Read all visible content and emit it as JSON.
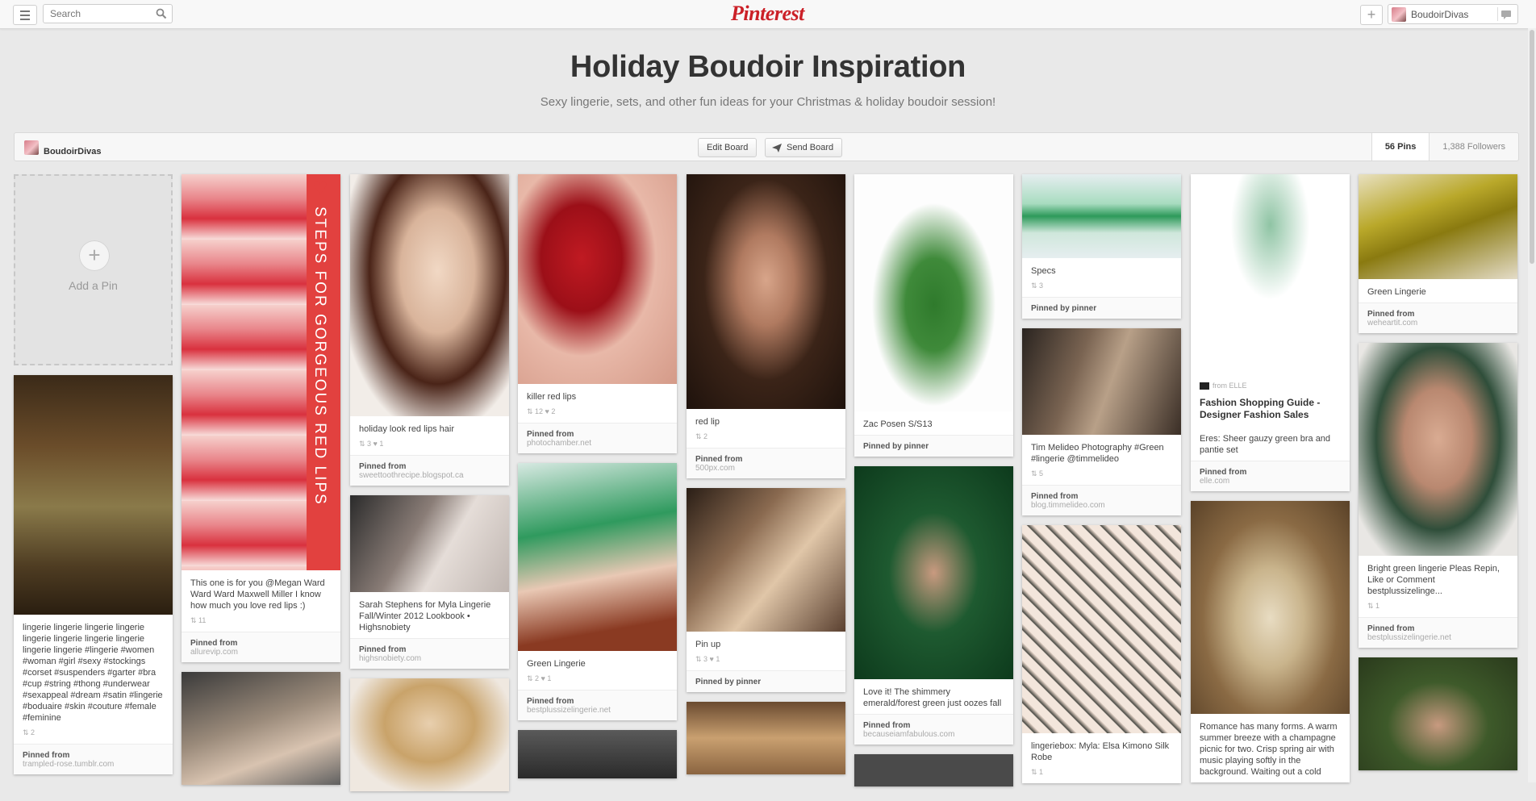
{
  "topbar": {
    "search_placeholder": "Search",
    "logo": "Pinterest",
    "username": "BoudoirDivas"
  },
  "board": {
    "title": "Holiday Boudoir Inspiration",
    "description": "Sexy lingerie, sets, and other fun ideas for your Christmas & holiday boudoir session!",
    "owner": "BoudoirDivas",
    "edit_label": "Edit Board",
    "send_label": "Send Board",
    "pins_count": "56 Pins",
    "followers_count": "1,388 Followers"
  },
  "add_pin_label": "Add a Pin",
  "pins": {
    "p1": {
      "desc": "lingerie lingerie lingerie lingerie lingerie lingerie lingerie lingerie lingerie lingerie #lingerie #women #woman #girl #sexy #stockings #corset #suspenders #garter #bra #cup #string #thong #underwear #sexappeal #dream #satin #lingerie #boduaire #skin #couture #female #feminine",
      "counts": "2",
      "src_label": "Pinned from",
      "src": "trampled-rose.tumblr.com"
    },
    "p2": {
      "desc": "This one is for you @Megan Ward Ward Ward Maxwell Miller I know how much you love red lips :)",
      "counts": "11",
      "src_label": "Pinned from",
      "src": "allurevip.com",
      "overlay": "STEPS FOR GORGEOUS RED LIPS"
    },
    "p3": {
      "desc": "holiday look red lips hair",
      "counts": "3  ♥ 1",
      "src_label": "Pinned from",
      "src": "sweettoothrecipe.blogspot.ca"
    },
    "p4": {
      "desc": "Sarah Stephens for Myla Lingerie Fall/Winter 2012 Lookbook • Highsnobiety",
      "src_label": "Pinned from",
      "src": "highsnobiety.com"
    },
    "p5": {
      "desc": "killer red lips",
      "counts": "12  ♥ 2",
      "src_label": "Pinned from",
      "src": "photochamber.net"
    },
    "p6": {
      "desc": "Green Lingerie",
      "counts": "2  ♥ 1",
      "src_label": "Pinned from",
      "src": "bestplussizelingerie.net"
    },
    "p7": {
      "desc": "red lip",
      "counts": "2",
      "src_label": "Pinned from",
      "src": "500px.com"
    },
    "p8": {
      "desc": "Pin up",
      "counts": "3  ♥ 1",
      "src_label": "Pinned by pinner"
    },
    "p9": {
      "desc": "Zac Posen S/S13",
      "src_label": "Pinned by pinner"
    },
    "p10": {
      "desc": "Love it! The shimmery emerald/forest green just oozes fall",
      "src_label": "Pinned from",
      "src": "becauseiamfabulous.com"
    },
    "p11": {
      "desc": "Specs",
      "counts": "3",
      "src_label": "Pinned by pinner"
    },
    "p12": {
      "desc": "Tim Melideo Photography #Green #lingerie @timmelideo",
      "counts": "5",
      "src_label": "Pinned from",
      "src": "blog.timmelideo.com"
    },
    "p13": {
      "desc": "lingeriebox: Myla: Elsa Kimono Silk Robe",
      "counts": "1"
    },
    "p14": {
      "from": "from ELLE",
      "title": "Fashion Shopping Guide - Designer Fashion Sales",
      "desc": "Eres: Sheer gauzy green bra and pantie set",
      "src_label": "Pinned from",
      "src": "elle.com"
    },
    "p15": {
      "desc": "Romance has many forms. A warm summer breeze with a champagne picnic for two. Crisp spring air with music playing softly in the background.  Waiting out a cold"
    },
    "p16": {
      "desc": "Green Lingerie",
      "src_label": "Pinned from",
      "src": "weheartit.com"
    },
    "p17": {
      "desc": "Bright green lingerie Pleas Repin, Like or Comment bestplussizelinge...",
      "counts": "1",
      "src_label": "Pinned from",
      "src": "bestplussizelingerie.net"
    }
  }
}
